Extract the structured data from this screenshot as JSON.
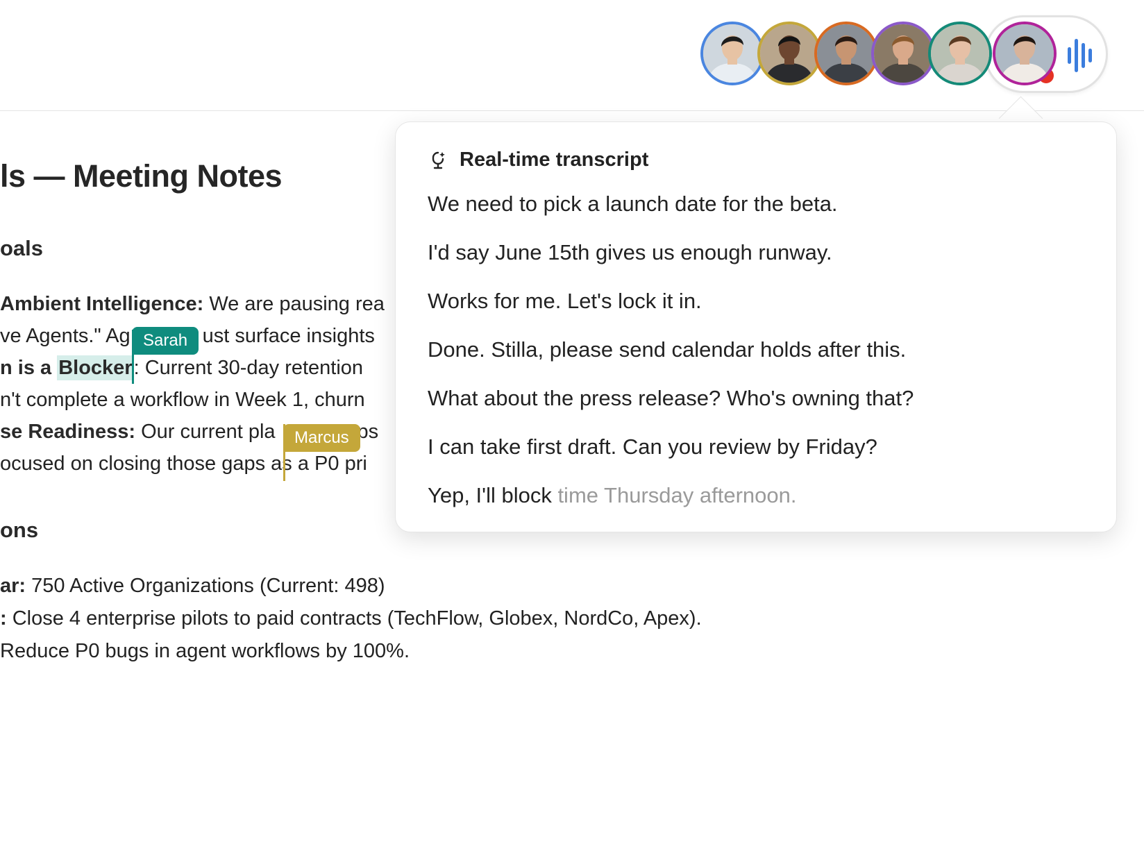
{
  "colors": {
    "sarah": "#0f8c7e",
    "marcus": "#c4a73a",
    "recording": "#e53224",
    "voice": "#3b7ddd"
  },
  "participants": [
    {
      "name": "participant-1",
      "ring": "#4a86e0",
      "skin": "#e7c3a4",
      "hair": "#1d1d1d",
      "shirt": "#e9eef3",
      "bg": "#cfd7de"
    },
    {
      "name": "participant-2",
      "ring": "#c4a73a",
      "skin": "#6d4630",
      "hair": "#141414",
      "shirt": "#2a2b2e",
      "bg": "#b9a68c"
    },
    {
      "name": "participant-3",
      "ring": "#d86a22",
      "skin": "#c79572",
      "hair": "#2a1b14",
      "shirt": "#3b3f45",
      "bg": "#8a8f96"
    },
    {
      "name": "participant-4",
      "ring": "#8b59c9",
      "skin": "#d9a98a",
      "hair": "#8a5a2e",
      "shirt": "#4c4740",
      "bg": "#8a7a66"
    },
    {
      "name": "participant-5",
      "ring": "#148a78",
      "skin": "#e6c0a6",
      "hair": "#5a3a22",
      "shirt": "#dad5cf",
      "bg": "#b8c0b3"
    },
    {
      "name": "participant-6",
      "ring": "#b0239a",
      "skin": "#d8b39a",
      "hair": "#1f1611",
      "shirt": "#f0ebe6",
      "bg": "#aeb9c4"
    }
  ],
  "doc": {
    "title": "ls — Meeting Notes",
    "section1": "oals",
    "section2": "ons",
    "lines": {
      "l1_bold": "Ambient Intelligence:",
      "l1_rest": " We are pausing rea",
      "l2_a": "ve Agents.\" Ag",
      "l2_b": "ust surface insights",
      "l3_bold": "n is a ",
      "l3_hl": "Blocker",
      "l3_rest": ": Current 30-day retention",
      "l4": "n't complete a workflow in Week 1, churn",
      "l5_bold": "se Readiness:",
      "l5_a": " Our current pla",
      "l5_b": "ps",
      "l6_a": "ocused on closing those gaps",
      "l6_b": " as a P0 pri",
      "m1_bold": "ar:",
      "m1_rest": " 750 Active Organizations (Current: 498)",
      "m2_bold": ":",
      "m2_rest": " Close 4 enterprise pilots to paid contracts (TechFlow, Globex, NordCo, Apex).",
      "m3": " Reduce P0 bugs in agent workflows by 100%."
    }
  },
  "cursors": {
    "sarah": "Sarah",
    "marcus": "Marcus"
  },
  "transcript": {
    "title": "Real-time transcript",
    "lines": [
      "We need to pick a launch date for the beta.",
      "I'd say June 15th gives us enough runway.",
      "Works for me. Let's lock it in.",
      "Done. Stilla, please send calendar holds after this.",
      "What about the press release? Who's owning that?",
      "I can take first draft. Can you review by Friday?"
    ],
    "last_spoken": "Yep, I'll block",
    "last_pending": " time Thursday afternoon."
  }
}
